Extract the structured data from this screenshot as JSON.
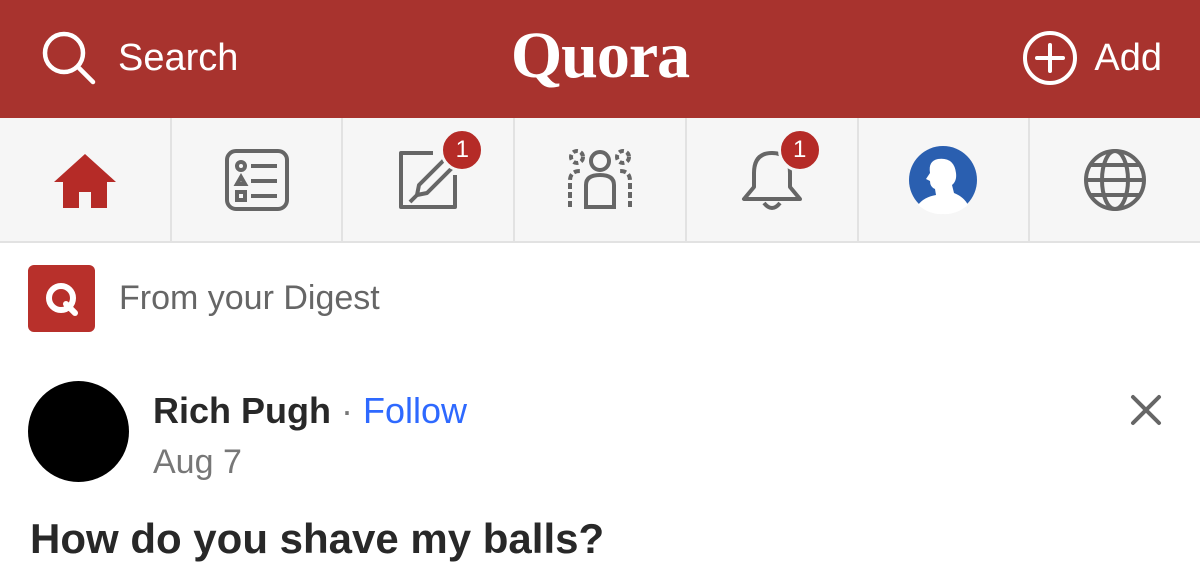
{
  "header": {
    "search_label": "Search",
    "logo_text": "Quora",
    "add_label": "Add",
    "background_color": "#a8332e"
  },
  "nav": {
    "items": [
      {
        "icon": "home-icon",
        "active": true
      },
      {
        "icon": "following-list-icon"
      },
      {
        "icon": "answer-pencil-icon",
        "badge": "1"
      },
      {
        "icon": "spaces-people-icon"
      },
      {
        "icon": "bell-icon",
        "badge": "1"
      },
      {
        "icon": "profile-avatar-icon"
      },
      {
        "icon": "globe-icon"
      }
    ]
  },
  "digest": {
    "logo_letter": "Q",
    "label": "From your Digest"
  },
  "post": {
    "author": "Rich Pugh",
    "separator": "·",
    "follow_label": "Follow",
    "date": "Aug 7",
    "question": "How do you shave my balls?"
  },
  "colors": {
    "brand": "#a8332e",
    "link": "#2e69ff",
    "badge": "#b52b27"
  }
}
